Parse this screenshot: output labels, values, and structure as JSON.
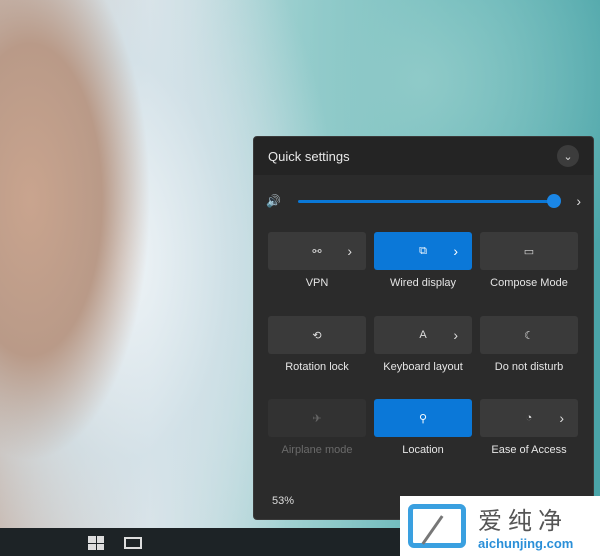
{
  "panel": {
    "title": "Quick settings",
    "collapse_icon": "chevron-down-icon"
  },
  "volume": {
    "level": 1.0,
    "icon": "speaker-icon",
    "more": "›"
  },
  "tiles": [
    {
      "label": "VPN",
      "icon": "⚯",
      "chev": "›",
      "state": "off"
    },
    {
      "label": "Wired display",
      "icon": "⧉",
      "chev": "›",
      "state": "on"
    },
    {
      "label": "Compose Mode",
      "icon": "▭",
      "state": "off"
    },
    {
      "label": "Rotation lock",
      "icon": "⟲",
      "state": "off"
    },
    {
      "label": "Keyboard layout",
      "icon": "A",
      "chev": "›",
      "state": "off"
    },
    {
      "label": "Do not disturb",
      "icon": "☾",
      "state": "off"
    },
    {
      "label": "Airplane mode",
      "icon": "✈",
      "state": "disabled"
    },
    {
      "label": "Location",
      "icon": "⚲",
      "state": "on"
    },
    {
      "label": "Ease of Access",
      "icon": "◔",
      "chev": "›",
      "state": "off"
    }
  ],
  "battery": "53%",
  "watermark": {
    "cn": "爱纯净",
    "en": "aichunjing.com"
  }
}
